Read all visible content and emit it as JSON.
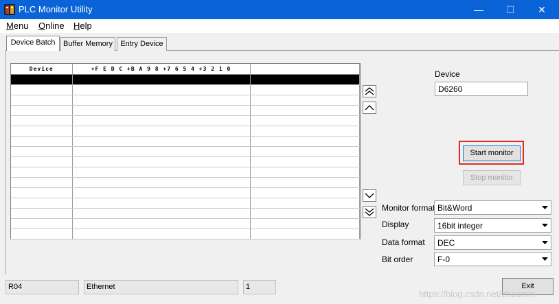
{
  "window": {
    "title": "PLC Monitor Utility",
    "icons": {
      "app": "plc-app-icon",
      "minimize": "minimize-icon",
      "maximize": "maximize-icon",
      "close": "close-icon"
    }
  },
  "menu": {
    "items": [
      {
        "accel": "M",
        "rest": "enu"
      },
      {
        "accel": "O",
        "rest": "nline"
      },
      {
        "accel": "H",
        "rest": "elp"
      }
    ]
  },
  "tabs": [
    "Device Batch",
    "Buffer Memory",
    "Entry Device"
  ],
  "grid": {
    "headers": [
      "Device",
      "+F E D C +B A 9 8 +7 6 5 4 +3 2 1 0",
      ""
    ],
    "rows": 16,
    "selected_row": 0
  },
  "scroll_buttons": [
    "page-up-icon",
    "line-up-icon",
    "line-down-icon",
    "page-down-icon"
  ],
  "device": {
    "label": "Device",
    "value": "D6260"
  },
  "buttons": {
    "start": "Start monitor",
    "stop": "Stop monitor",
    "exit": "Exit"
  },
  "settings": [
    {
      "label": "Monitor format",
      "value": "Bit&Word"
    },
    {
      "label": "Display",
      "value": "16bit integer"
    },
    {
      "label": "Data format",
      "value": "DEC"
    },
    {
      "label": "Bit order",
      "value": "F-0"
    }
  ],
  "status": {
    "plc": "R04",
    "connection": "Ethernet",
    "station": "1"
  },
  "watermark": "https://blog.csdn.net/zhoumin",
  "colors": {
    "titlebar": "#0a64d8",
    "highlight": "#e8281e",
    "selected_row": "#000000"
  }
}
